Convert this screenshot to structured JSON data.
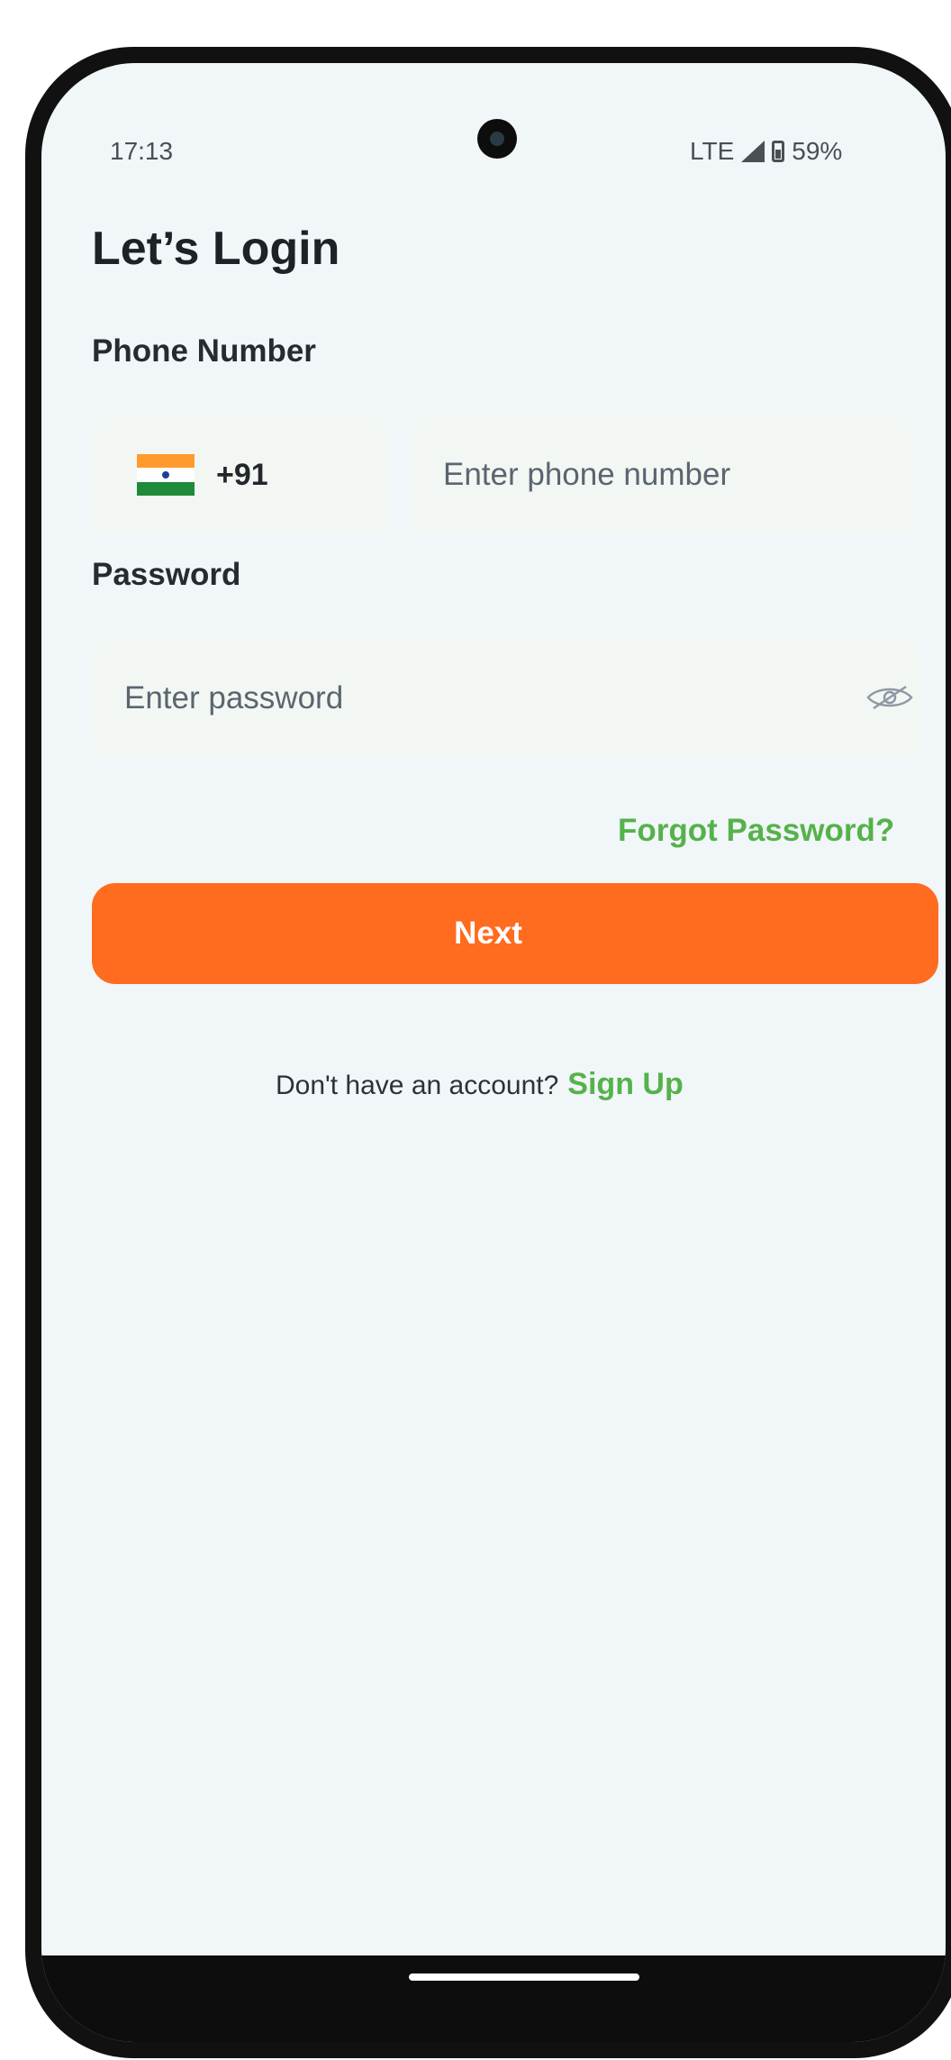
{
  "status_bar": {
    "time": "17:13",
    "network": "LTE",
    "battery": "59%"
  },
  "login": {
    "title": "Let’s Login",
    "phone_label": "Phone Number",
    "country_code": "+91",
    "phone_placeholder": "Enter phone number",
    "password_label": "Password",
    "password_placeholder": "Enter password",
    "forgot_password": "Forgot Password?",
    "next_button": "Next",
    "signup_prompt": "Don't have an account?",
    "signup_link": "Sign Up"
  },
  "colors": {
    "accent": "#ff6b1f",
    "link": "#55b24a",
    "background": "#f1f6f8"
  },
  "icons": [
    "india-flag-icon",
    "eye-icon",
    "signal-icon",
    "battery-icon",
    "camera-icon"
  ]
}
